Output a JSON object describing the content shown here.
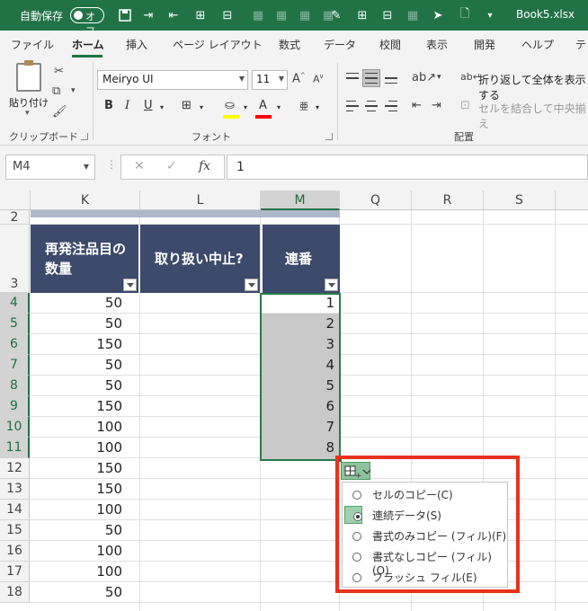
{
  "titlebar": {
    "autosave_label": "自動保存",
    "autosave_state": "オフ",
    "filename": "Book5.xlsx",
    "qat_icons": [
      "save-icon",
      "insert-cells-icon",
      "delete-cells-icon",
      "insert-rows-icon",
      "delete-rows-icon",
      "grid-icon",
      "grid-icon",
      "grid-icon",
      "grid-icon",
      "format-painter-icon",
      "insert-columns-icon",
      "delete-columns-icon",
      "table-icon",
      "select-pointer-icon",
      "new-doc-icon",
      "customize-dropdown-icon"
    ]
  },
  "ribbon_tabs": [
    "ファイル",
    "ホーム",
    "挿入",
    "ページ レイアウト",
    "数式",
    "データ",
    "校閲",
    "表示",
    "開発",
    "ヘルプ",
    "テ"
  ],
  "active_tab": "ホーム",
  "ribbon": {
    "clipboard": {
      "paste_label": "貼り付け",
      "group_label": "クリップボード"
    },
    "font": {
      "font_name": "Meiryo UI",
      "font_size": "11",
      "group_label": "フォント",
      "fill_color": "#ffff00",
      "font_color": "#ff0000"
    },
    "alignment": {
      "wrap_text": "折り返して全体を表示する",
      "merge_center": "セルを結合して中央揃え",
      "group_label": "配置"
    }
  },
  "formula_bar": {
    "name_box": "M4",
    "value": "1",
    "fx_label": "fx"
  },
  "columns": [
    "K",
    "L",
    "M",
    "Q",
    "R",
    "S"
  ],
  "selected_column": "M",
  "rows": [
    "2",
    "3",
    "4",
    "5",
    "6",
    "7",
    "8",
    "9",
    "10",
    "11",
    "12",
    "13",
    "14",
    "15",
    "16",
    "17",
    "18"
  ],
  "selected_rows": [
    "4",
    "5",
    "6",
    "7",
    "8",
    "9",
    "10",
    "11"
  ],
  "table": {
    "headers": [
      {
        "line1": "再発注品目の",
        "line2": "数量"
      },
      {
        "line1": "取り扱い中止?",
        "line2": ""
      },
      {
        "line1": "連番",
        "line2": ""
      }
    ],
    "k_values": [
      "50",
      "50",
      "150",
      "50",
      "50",
      "150",
      "100",
      "100",
      "150",
      "150",
      "100",
      "50",
      "100",
      "100",
      "50"
    ],
    "m_values": [
      "1",
      "2",
      "3",
      "4",
      "5",
      "6",
      "7",
      "8"
    ]
  },
  "autofill_menu": {
    "items": [
      {
        "label": "セルのコピー(C)",
        "checked": false
      },
      {
        "label": "連続データ(S)",
        "checked": true
      },
      {
        "label": "書式のみコピー (フィル)(F)",
        "checked": false
      },
      {
        "label": "書式なしコピー (フィル)(O)",
        "checked": false
      },
      {
        "label": "フラッシュ フィル(E)",
        "checked": false
      }
    ]
  },
  "colors": {
    "excel_green": "#217346",
    "header_navy": "#3c4a6b",
    "highlight_red": "#e8321b"
  }
}
